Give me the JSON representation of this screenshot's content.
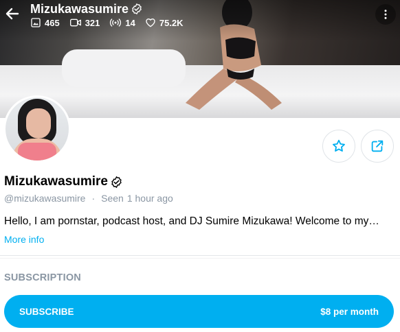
{
  "header": {
    "title": "Mizukawasumire",
    "stats": {
      "photos": "465",
      "videos": "321",
      "streams": "14",
      "likes": "75.2K"
    }
  },
  "profile": {
    "name": "Mizukawasumire",
    "handle": "@mizukawasumire",
    "separator": "·",
    "seen_label": "Seen",
    "seen_value": "1 hour ago",
    "bio": "Hello, I am pornstar, podcast host, and DJ Sumire Mizukawa! Welcome to my…",
    "more_info": "More info"
  },
  "subscription": {
    "heading": "SUBSCRIPTION",
    "button_label": "SUBSCRIBE",
    "price": "$8 per month"
  },
  "colors": {
    "accent": "#00aff0",
    "muted_text": "#8a96a3",
    "border": "#dfe3e7"
  },
  "icons": [
    "back-arrow-icon",
    "verified-icon",
    "image-icon",
    "video-icon",
    "broadcast-icon",
    "heart-icon",
    "more-icon",
    "star-icon",
    "share-icon"
  ]
}
